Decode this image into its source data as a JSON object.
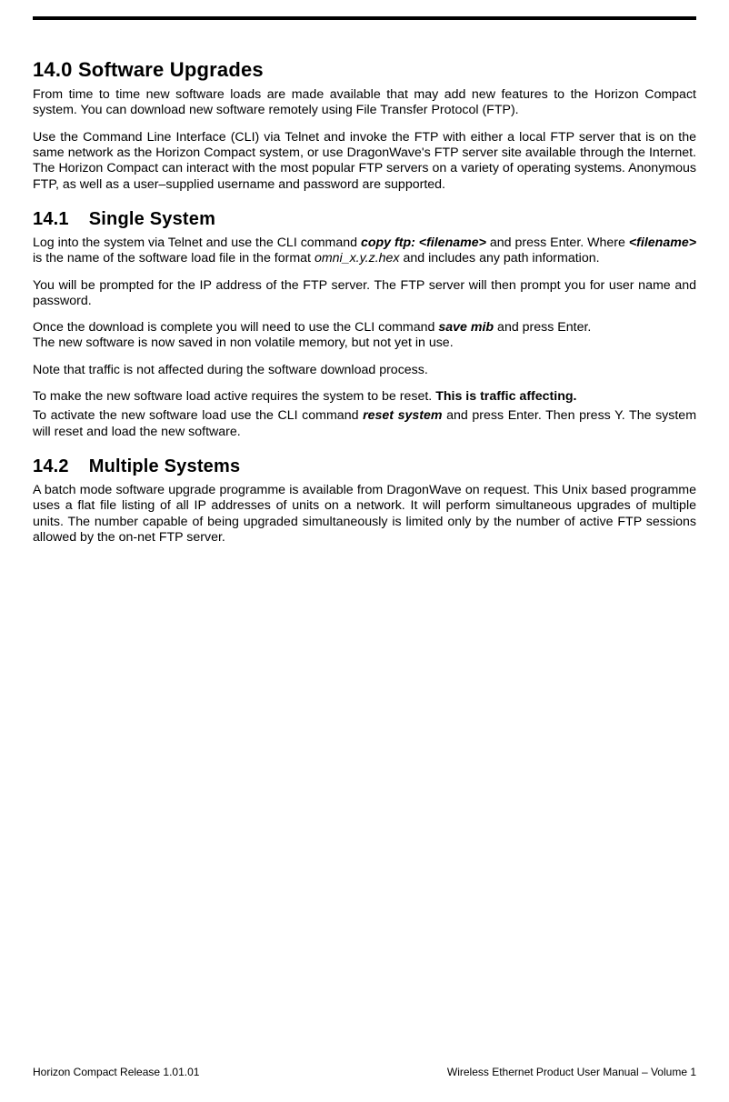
{
  "section_number": "14.0",
  "section_title": "Software Upgrades",
  "p1": "From time to time new software loads are made available that may add new features to the Horizon Compact system. You can download new software remotely using File Transfer Protocol (FTP).",
  "p2": "Use the Command Line Interface (CLI) via Telnet and invoke the FTP with either a local FTP server that is on the same network as the Horizon Compact system, or use DragonWave's FTP server site available through the Internet. The Horizon Compact can interact with the most popular FTP servers on a variety of operating systems. Anonymous FTP, as well as a user–supplied username and password are supported.",
  "sub1_number": "14.1",
  "sub1_title": "Single System",
  "s1p1a": "Log into the system via Telnet and use the CLI command ",
  "s1p1_cmd1": "copy ftp: <filename>",
  "s1p1b": " and press Enter. Where ",
  "s1p1_fn": "<filename>",
  "s1p1c": " is the name of the software load file in the format ",
  "s1p1_fmt": "omni_x.y.z.hex",
  "s1p1d": " and includes any path information.",
  "s1p2": "You will be prompted for the IP address of the FTP server. The FTP server will then prompt you for user name and password.",
  "s1p3a": "Once the download is complete you will need to use the CLI command ",
  "s1p3_cmd": "save mib",
  "s1p3b": " and press Enter.",
  "s1p3c": "The new software is now saved in non volatile memory, but not yet in use.",
  "s1p4": "Note that traffic is not affected during the software download process.",
  "s1p5a": "To make the new software load active requires the system to be reset. ",
  "s1p5b": "This is traffic affecting.",
  "s1p6a": "To activate the new software load use the CLI command ",
  "s1p6_cmd": "reset system",
  "s1p6b": " and press Enter. Then press Y. The system will reset and load the new software.",
  "sub2_number": "14.2",
  "sub2_title": "Multiple Systems",
  "s2p1": "A batch mode software upgrade programme is available from DragonWave on request. This Unix based programme uses a flat file listing of all IP addresses of units on a network. It will perform simultaneous upgrades of multiple units. The number capable of being upgraded simultaneously is limited only by the number of active FTP sessions allowed by the on-net FTP server.",
  "footer_left": "Horizon Compact Release 1.01.01",
  "footer_right": "Wireless Ethernet Product User Manual – Volume 1"
}
